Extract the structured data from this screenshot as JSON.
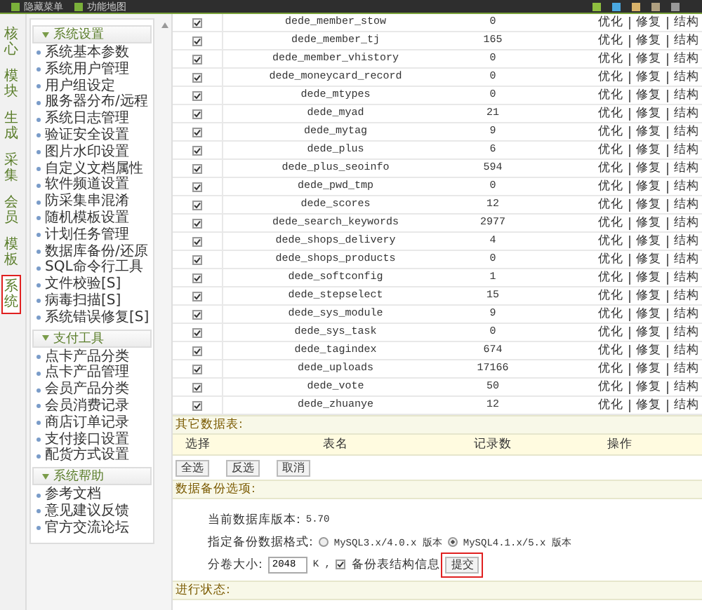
{
  "topbar": {
    "links": [
      "隐藏菜单",
      "功能地图"
    ]
  },
  "tabs": [
    {
      "label": "核心",
      "selected": false
    },
    {
      "label": "模块",
      "selected": false
    },
    {
      "label": "生成",
      "selected": false
    },
    {
      "label": "采集",
      "selected": false
    },
    {
      "label": "会员",
      "selected": false
    },
    {
      "label": "模板",
      "selected": false
    },
    {
      "label": "系统",
      "selected": true
    }
  ],
  "menu": [
    {
      "title": "系统设置",
      "items": [
        "系统基本参数",
        "系统用户管理",
        "用户组设定",
        "服务器分布/远程",
        "系统日志管理",
        "验证安全设置",
        "图片水印设置",
        "自定义文档属性",
        "软件频道设置",
        "防采集串混淆",
        "随机模板设置",
        "计划任务管理",
        "数据库备份/还原",
        "SQL命令行工具",
        "文件校验[S]",
        "病毒扫描[S]",
        "系统错误修复[S]"
      ]
    },
    {
      "title": "支付工具",
      "items": [
        "点卡产品分类",
        "点卡产品管理",
        "会员产品分类",
        "会员消费记录",
        "商店订单记录",
        "支付接口设置",
        "配货方式设置"
      ]
    },
    {
      "title": "系统帮助",
      "items": [
        "参考文档",
        "意见建议反馈",
        "官方交流论坛"
      ]
    }
  ],
  "tables": [
    {
      "name": "dede_member_stow",
      "count": "0",
      "checked": true
    },
    {
      "name": "dede_member_tj",
      "count": "165",
      "checked": true
    },
    {
      "name": "dede_member_vhistory",
      "count": "0",
      "checked": true
    },
    {
      "name": "dede_moneycard_record",
      "count": "0",
      "checked": true
    },
    {
      "name": "dede_mtypes",
      "count": "0",
      "checked": true
    },
    {
      "name": "dede_myad",
      "count": "21",
      "checked": true
    },
    {
      "name": "dede_mytag",
      "count": "9",
      "checked": true
    },
    {
      "name": "dede_plus",
      "count": "6",
      "checked": true
    },
    {
      "name": "dede_plus_seoinfo",
      "count": "594",
      "checked": true
    },
    {
      "name": "dede_pwd_tmp",
      "count": "0",
      "checked": true
    },
    {
      "name": "dede_scores",
      "count": "12",
      "checked": true
    },
    {
      "name": "dede_search_keywords",
      "count": "2977",
      "checked": true
    },
    {
      "name": "dede_shops_delivery",
      "count": "4",
      "checked": true
    },
    {
      "name": "dede_shops_products",
      "count": "0",
      "checked": true
    },
    {
      "name": "dede_softconfig",
      "count": "1",
      "checked": true
    },
    {
      "name": "dede_stepselect",
      "count": "15",
      "checked": true
    },
    {
      "name": "dede_sys_module",
      "count": "9",
      "checked": true
    },
    {
      "name": "dede_sys_task",
      "count": "0",
      "checked": true
    },
    {
      "name": "dede_tagindex",
      "count": "674",
      "checked": true
    },
    {
      "name": "dede_uploads",
      "count": "17166",
      "checked": true
    },
    {
      "name": "dede_vote",
      "count": "50",
      "checked": true
    },
    {
      "name": "dede_zhuanye",
      "count": "12",
      "checked": true
    }
  ],
  "row_actions": [
    [
      "优化",
      "修复",
      "结构"
    ],
    [
      "优化",
      "修复",
      "结构"
    ],
    [
      "优化",
      "修复",
      "结构"
    ],
    [
      "优化",
      "修复",
      "结构"
    ],
    [
      "优化",
      "修复",
      "结构"
    ],
    [
      "优化",
      "修复",
      "结构"
    ],
    [
      "优化",
      "修复",
      "结构"
    ],
    [
      "优化",
      "修复",
      "结构"
    ],
    [
      "优化",
      "修复",
      "结构"
    ],
    [
      "优化",
      "修复",
      "结构"
    ],
    [
      "优化",
      "修复",
      "结构"
    ],
    [
      "优化",
      "修复",
      "结构"
    ],
    [
      "优化",
      "修复",
      "结构"
    ],
    [
      "优化",
      "修复",
      "结构"
    ],
    [
      "优化",
      "修复",
      "结构"
    ],
    [
      "优化",
      "修复",
      "结构"
    ],
    [
      "优化",
      "修复",
      "结构"
    ],
    [
      "优化",
      "修复",
      "结构"
    ],
    [
      "优化",
      "修复",
      "结构"
    ],
    [
      "优化",
      "修复",
      "结构"
    ],
    [
      "优化",
      "修复",
      "结构"
    ],
    [
      "优化",
      "修复",
      "结构"
    ]
  ],
  "other_tables": {
    "title": "其它数据表:",
    "columns": [
      "选择",
      "表名",
      "记录数",
      "操作"
    ],
    "buttons": [
      "全选",
      "反选",
      "取消"
    ]
  },
  "backup": {
    "title": "数据备份选项:",
    "version_label": "当前数据库版本:",
    "version": "5.70",
    "format_label": "指定备份数据格式:",
    "formats": [
      {
        "label": "MySQL3.x/4.0.x 版本",
        "selected": false
      },
      {
        "label": "MySQL4.1.x/5.x 版本",
        "selected": true
      }
    ],
    "size_label": "分卷大小:",
    "size_value": "2048",
    "size_unit": "K ,",
    "structure": {
      "label": "备份表结构信息",
      "checked": true
    },
    "submit": "提交"
  },
  "status_title": "进行状态:"
}
